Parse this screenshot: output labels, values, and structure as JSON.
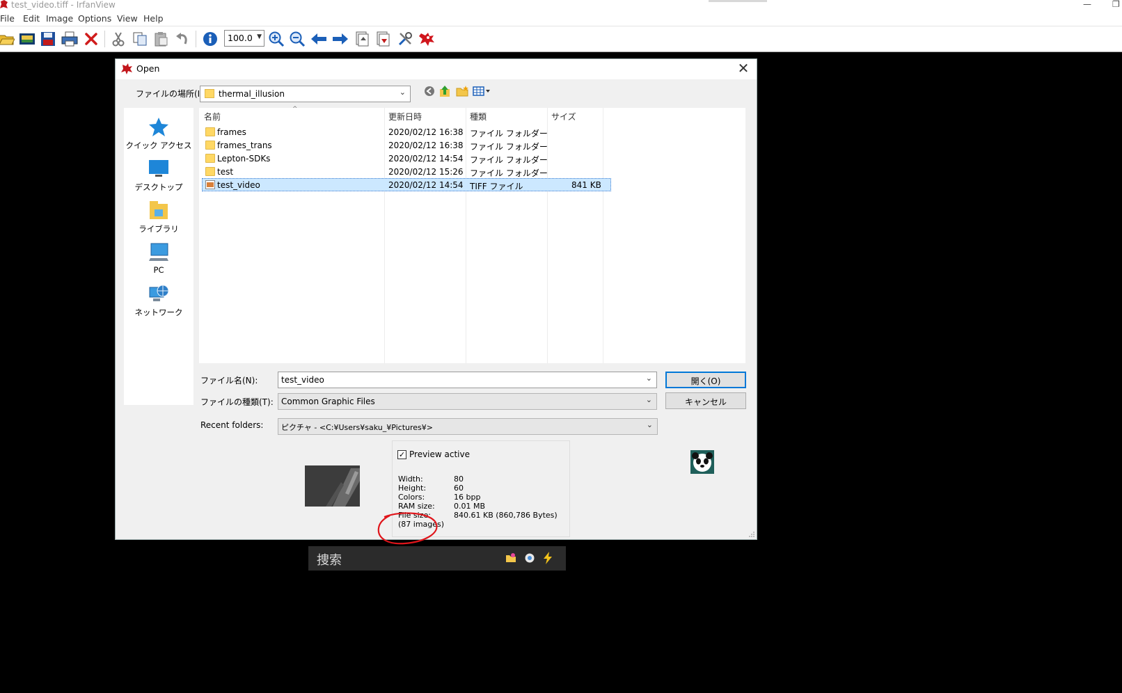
{
  "window": {
    "title": "test_video.tiff - IrfanView",
    "minimize_glyph": "—",
    "restore_glyph": "❐"
  },
  "menu": [
    "File",
    "Edit",
    "Image",
    "Options",
    "View",
    "Help"
  ],
  "toolbar": {
    "zoom_value": "100.0",
    "icons": [
      "open-folder-icon",
      "thumbnails-icon",
      "save-icon",
      "print-icon",
      "delete-icon",
      "cut-icon",
      "copy-icon",
      "paste-icon",
      "undo-icon",
      "info-icon",
      "zoom-in-icon",
      "zoom-out-icon",
      "previous-icon",
      "next-icon",
      "first-page-icon",
      "last-page-icon",
      "settings-icon",
      "irfanview-logo-icon"
    ]
  },
  "dialog": {
    "title": "Open",
    "close_glyph": "✕",
    "look_in_label": "ファイルの場所(I):",
    "look_in_value": "thermal_illusion",
    "places": [
      {
        "label": "クイック アクセス",
        "icon": "star-icon"
      },
      {
        "label": "デスクトップ",
        "icon": "desktop-icon"
      },
      {
        "label": "ライブラリ",
        "icon": "library-icon"
      },
      {
        "label": "PC",
        "icon": "pc-icon"
      },
      {
        "label": "ネットワーク",
        "icon": "network-icon"
      }
    ],
    "columns": [
      "名前",
      "更新日時",
      "種類",
      "サイズ"
    ],
    "files": [
      {
        "name": "frames",
        "date": "2020/02/12 16:38",
        "type": "ファイル フォルダー",
        "size": "",
        "kind": "folder"
      },
      {
        "name": "frames_trans",
        "date": "2020/02/12 16:38",
        "type": "ファイル フォルダー",
        "size": "",
        "kind": "folder"
      },
      {
        "name": "Lepton-SDKs",
        "date": "2020/02/12 14:54",
        "type": "ファイル フォルダー",
        "size": "",
        "kind": "folder"
      },
      {
        "name": "test",
        "date": "2020/02/12 15:26",
        "type": "ファイル フォルダー",
        "size": "",
        "kind": "folder"
      },
      {
        "name": "test_video",
        "date": "2020/02/12 14:54",
        "type": "TIFF ファイル",
        "size": "841 KB",
        "kind": "file",
        "selected": true
      }
    ],
    "filename_label": "ファイル名(N):",
    "filename_value": "test_video",
    "filetype_label": "ファイルの種類(T):",
    "filetype_value": "Common Graphic Files",
    "recent_label": "Recent folders:",
    "recent_value": "ピクチャ  -  <C:¥Users¥saku_¥Pictures¥>",
    "open_button": "開く(O)",
    "cancel_button": "キャンセル",
    "preview_active_label": "Preview active",
    "preview_checked": "✓",
    "info": {
      "width_label": "Width:",
      "width_value": "80",
      "height_label": "Height:",
      "height_value": "60",
      "colors_label": "Colors:",
      "colors_value": "16 bpp",
      "ram_label": "RAM size:",
      "ram_value": "0.01 MB",
      "filesize_label": "File size:",
      "filesize_value": "840.61 KB (860,786 Bytes)",
      "images_count": "(87 images)"
    }
  },
  "taskbar": {
    "search_placeholder": "捜索"
  },
  "colors": {
    "selection": "#cce8ff",
    "annotation_circle": "#e0151b",
    "primary_border": "#0078d7"
  }
}
